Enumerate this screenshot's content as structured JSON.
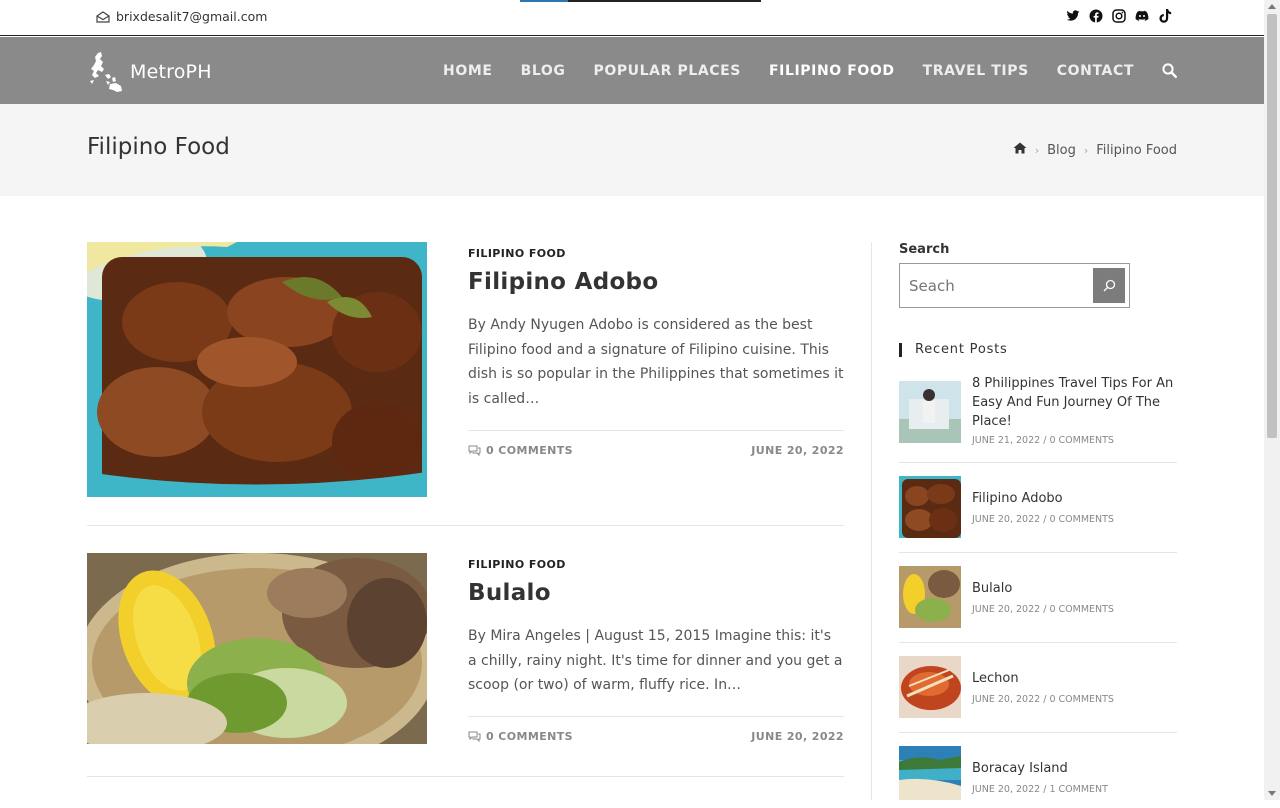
{
  "topbar": {
    "email": "brixdesalit7@gmail.com",
    "progress_fraction": 0.2,
    "social": [
      "twitter-icon",
      "facebook-icon",
      "instagram-icon",
      "discord-icon",
      "tiktok-icon"
    ]
  },
  "brand": {
    "name": "MetroPH"
  },
  "nav": {
    "items": [
      "HOME",
      "BLOG",
      "POPULAR PLACES",
      "FILIPINO FOOD",
      "TRAVEL TIPS",
      "CONTACT"
    ],
    "active": "FILIPINO FOOD"
  },
  "page": {
    "title": "Filipino Food"
  },
  "breadcrumb": {
    "home_icon": "home-icon",
    "blog": "Blog",
    "current": "Filipino Food"
  },
  "posts": [
    {
      "category": "FILIPINO FOOD",
      "title": "Filipino Adobo",
      "excerpt": "By Andy Nyugen Adobo is considered as the best Filipino food and a signature of Filipino cuisine. This dish is so popular in the Philippines that sometimes it is called…",
      "comments": "0 COMMENTS",
      "date": "JUNE 20, 2022"
    },
    {
      "category": "FILIPINO FOOD",
      "title": "Bulalo",
      "excerpt": "By Mira Angeles | August 15, 2015 Imagine this: it's a chilly, rainy night. It's time for dinner and you get a scoop (or two) of warm, fluffy rice. In…",
      "comments": "0 COMMENTS",
      "date": "JUNE 20, 2022"
    }
  ],
  "sidebar": {
    "search_label": "Search",
    "search_placeholder": "Seach",
    "recent_title": "Recent Posts",
    "recent": [
      {
        "title": "8 Philippines Travel Tips For An Easy And Fun Journey Of The Place!",
        "date": "JUNE 21, 2022",
        "comments": "0 COMMENTS"
      },
      {
        "title": "Filipino Adobo",
        "date": "JUNE 20, 2022",
        "comments": "0 COMMENTS"
      },
      {
        "title": "Bulalo",
        "date": "JUNE 20, 2022",
        "comments": "0 COMMENTS"
      },
      {
        "title": "Lechon",
        "date": "JUNE 20, 2022",
        "comments": "0 COMMENTS"
      },
      {
        "title": "Boracay Island",
        "date": "JUNE 20, 2022",
        "comments": "1 COMMENT"
      }
    ]
  },
  "colors": {
    "nav_bg": "#8a8a8a",
    "accent": "#2b77b0",
    "title_band": "#f5f5f5"
  }
}
